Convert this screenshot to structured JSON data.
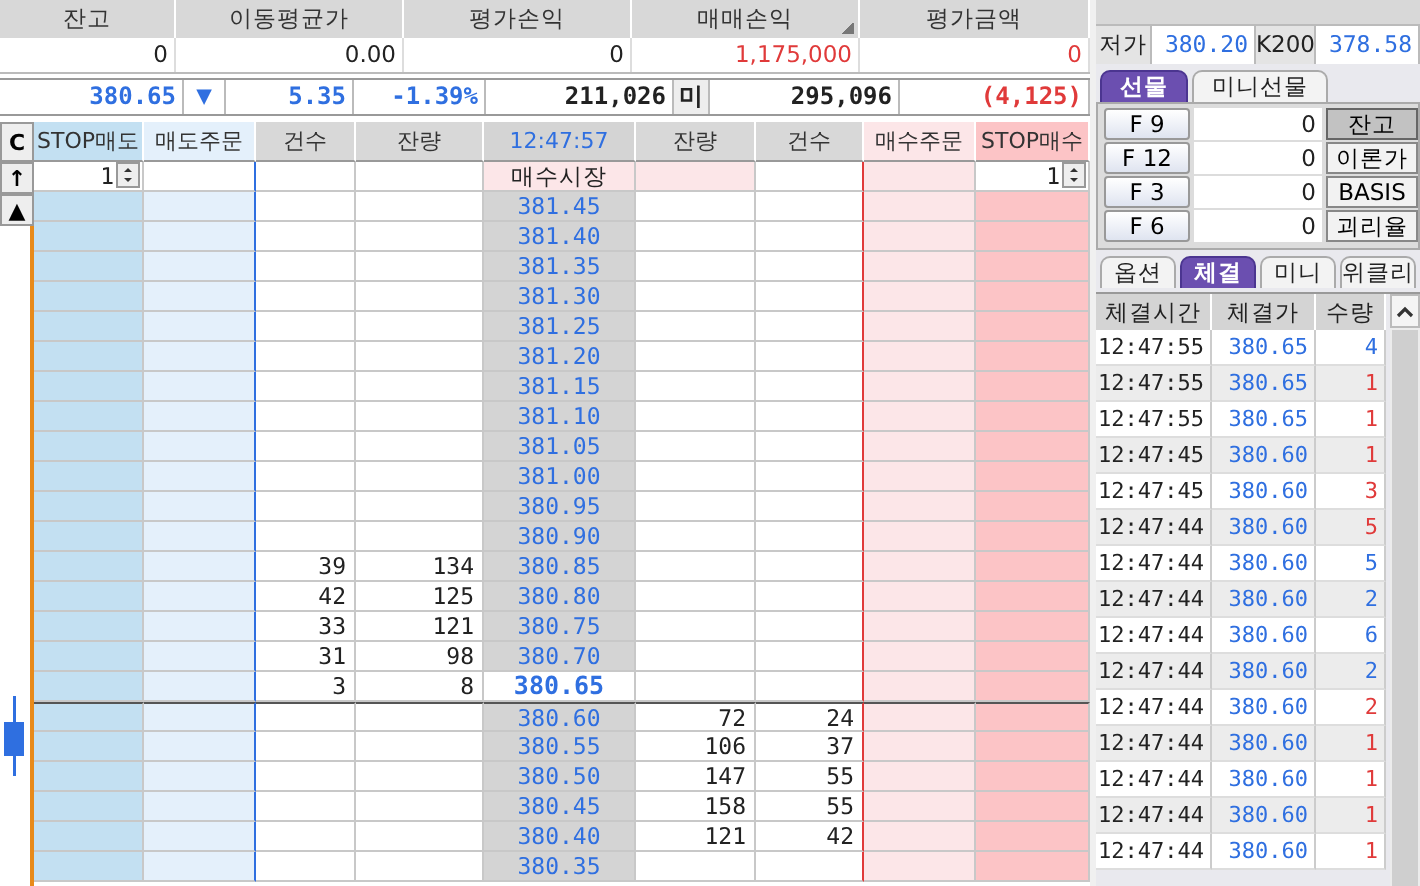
{
  "position_summary": {
    "columns": [
      {
        "label": "잔고",
        "sorted": false
      },
      {
        "label": "이동평균가",
        "sorted": false
      },
      {
        "label": "평가손익",
        "sorted": false
      },
      {
        "label": "매매손익",
        "sorted": true
      },
      {
        "label": "평가금액",
        "sorted": false
      }
    ],
    "values": [
      {
        "text": "0",
        "color": "#222222"
      },
      {
        "text": "0.00",
        "color": "#222222"
      },
      {
        "text": "0",
        "color": "#222222"
      },
      {
        "text": "1,175,000",
        "color": "#e03a3a"
      },
      {
        "text": "0",
        "color": "#e03a3a"
      }
    ]
  },
  "quote_bar": {
    "price": "380.65",
    "arrow": "▼",
    "change": "5.35",
    "change_rate": "-1.39%",
    "volume": "211,026",
    "label": "미",
    "open_interest": "295,096",
    "diff": "(4,125)"
  },
  "order_book": {
    "side_buttons": [
      "C",
      "↑",
      "▲"
    ],
    "columns": [
      "STOP매도",
      "매도주문",
      "건수",
      "잔량",
      "12:47:57",
      "잔량",
      "건수",
      "매수주문",
      "STOP매수"
    ],
    "stop_sell_qty": "1",
    "market_buy": "매수시장",
    "stop_buy_qty": "1",
    "rows": [
      {
        "price": "381.45",
        "current": false
      },
      {
        "price": "381.40",
        "current": false
      },
      {
        "price": "381.35",
        "current": false
      },
      {
        "price": "381.30",
        "current": false
      },
      {
        "price": "381.25",
        "current": false
      },
      {
        "price": "381.20",
        "current": false
      },
      {
        "price": "381.15",
        "current": false
      },
      {
        "price": "381.10",
        "current": false
      },
      {
        "price": "381.05",
        "current": false
      },
      {
        "price": "381.00",
        "current": false
      },
      {
        "price": "380.95",
        "current": false
      },
      {
        "price": "380.90",
        "current": false
      },
      {
        "price": "380.85",
        "sell_count": "39",
        "sell_remaining": "134",
        "current": false
      },
      {
        "price": "380.80",
        "sell_count": "42",
        "sell_remaining": "125",
        "current": false
      },
      {
        "price": "380.75",
        "sell_count": "33",
        "sell_remaining": "121",
        "current": false
      },
      {
        "price": "380.70",
        "sell_count": "31",
        "sell_remaining": "98",
        "current": false
      },
      {
        "price": "380.65",
        "sell_count": "3",
        "sell_remaining": "8",
        "current": true
      },
      {
        "price": "380.60",
        "buy_remaining": "72",
        "buy_count": "24",
        "current": false
      },
      {
        "price": "380.55",
        "buy_remaining": "106",
        "buy_count": "37",
        "current": false
      },
      {
        "price": "380.50",
        "buy_remaining": "147",
        "buy_count": "55",
        "current": false
      },
      {
        "price": "380.45",
        "buy_remaining": "158",
        "buy_count": "55",
        "current": false
      },
      {
        "price": "380.40",
        "buy_remaining": "121",
        "buy_count": "42",
        "current": false
      },
      {
        "price": "380.35",
        "current": false
      }
    ]
  },
  "quote_row": {
    "cells": [
      "저가",
      "380.20",
      "K200",
      "378.58"
    ]
  },
  "futures_tabs": [
    {
      "label": "선물",
      "selected": true
    },
    {
      "label": "미니선물",
      "selected": false
    }
  ],
  "contracts": [
    {
      "code": "F 9",
      "value": "0"
    },
    {
      "code": "F 12",
      "value": "0"
    },
    {
      "code": "F 3",
      "value": "0"
    },
    {
      "code": "F 6",
      "value": "0"
    }
  ],
  "view_buttons": [
    {
      "label": "잔고",
      "selected": true
    },
    {
      "label": "이론가",
      "selected": false
    },
    {
      "label": "BASIS",
      "selected": false
    },
    {
      "label": "괴리율",
      "selected": false
    }
  ],
  "trade_tabs": [
    {
      "label": "옵션",
      "selected": false
    },
    {
      "label": "체결",
      "selected": true
    },
    {
      "label": "미니",
      "selected": false
    },
    {
      "label": "위클리",
      "selected": false
    }
  ],
  "trades": {
    "columns": [
      "체결시간",
      "체결가",
      "수량"
    ],
    "rows": [
      {
        "time": "12:47:55",
        "price": "380.65",
        "qty": "4",
        "color": "#2f6fe0"
      },
      {
        "time": "12:47:55",
        "price": "380.65",
        "qty": "1",
        "color": "#e03a3a"
      },
      {
        "time": "12:47:55",
        "price": "380.65",
        "qty": "1",
        "color": "#e03a3a"
      },
      {
        "time": "12:47:45",
        "price": "380.60",
        "qty": "1",
        "color": "#e03a3a"
      },
      {
        "time": "12:47:45",
        "price": "380.60",
        "qty": "3",
        "color": "#e03a3a"
      },
      {
        "time": "12:47:44",
        "price": "380.60",
        "qty": "5",
        "color": "#e03a3a"
      },
      {
        "time": "12:47:44",
        "price": "380.60",
        "qty": "5",
        "color": "#2f6fe0"
      },
      {
        "time": "12:47:44",
        "price": "380.60",
        "qty": "2",
        "color": "#2f6fe0"
      },
      {
        "time": "12:47:44",
        "price": "380.60",
        "qty": "6",
        "color": "#2f6fe0"
      },
      {
        "time": "12:47:44",
        "price": "380.60",
        "qty": "2",
        "color": "#2f6fe0"
      },
      {
        "time": "12:47:44",
        "price": "380.60",
        "qty": "2",
        "color": "#e03a3a"
      },
      {
        "time": "12:47:44",
        "price": "380.60",
        "qty": "1",
        "color": "#e03a3a"
      },
      {
        "time": "12:47:44",
        "price": "380.60",
        "qty": "1",
        "color": "#e03a3a"
      },
      {
        "time": "12:47:44",
        "price": "380.60",
        "qty": "1",
        "color": "#e03a3a"
      },
      {
        "time": "12:47:44",
        "price": "380.60",
        "qty": "1",
        "color": "#e03a3a"
      }
    ]
  }
}
